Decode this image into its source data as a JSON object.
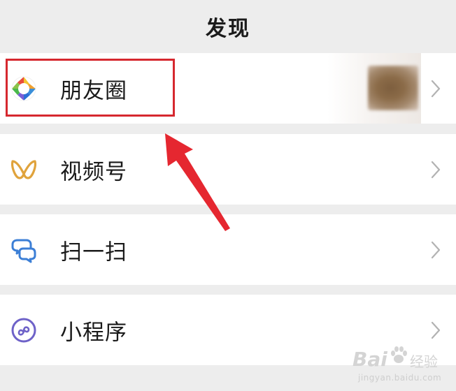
{
  "header": {
    "title": "发现"
  },
  "menu": {
    "items": [
      {
        "label": "朋友圈",
        "icon": "moments-aperture-icon"
      },
      {
        "label": "视频号",
        "icon": "channels-icon"
      },
      {
        "label": "扫一扫",
        "icon": "scan-icon"
      },
      {
        "label": "小程序",
        "icon": "mini-program-icon"
      }
    ]
  },
  "annotation": {
    "highlight_color": "#d6282f",
    "arrow_color": "#e52730"
  },
  "watermark": {
    "brand_latin": "Bai",
    "brand_cn": "经验",
    "url": "jingyan.baidu.com"
  },
  "colors": {
    "background": "#ededed",
    "row": "#ffffff",
    "chevron": "#b2b2b2"
  }
}
